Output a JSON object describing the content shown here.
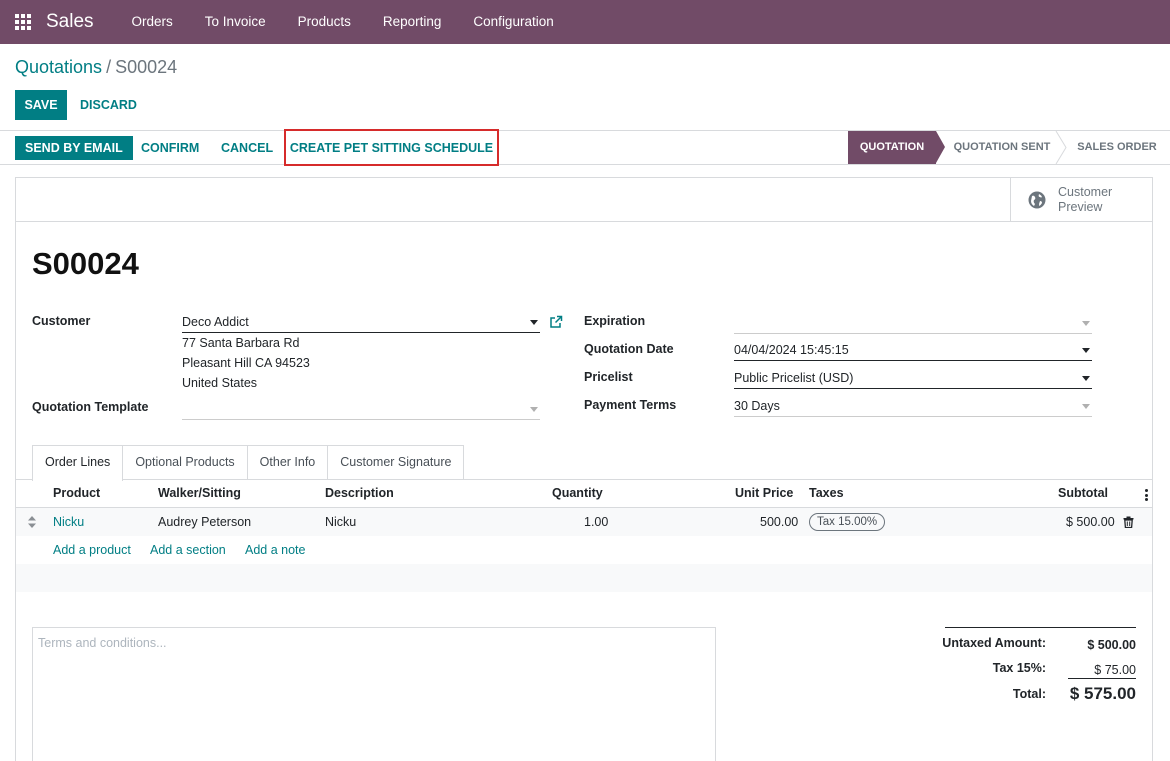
{
  "navbar": {
    "brand": "Sales",
    "menu": [
      "Orders",
      "To Invoice",
      "Products",
      "Reporting",
      "Configuration"
    ],
    "accent_color": "#714B67"
  },
  "breadcrumb": {
    "parent": "Quotations",
    "separator": "/",
    "current": "S00024"
  },
  "form_buttons": {
    "save": "SAVE",
    "discard": "DISCARD"
  },
  "statusbar": {
    "send_email": "SEND BY EMAIL",
    "confirm": "CONFIRM",
    "cancel": "CANCEL",
    "pet_schedule": "CREATE PET SITTING SCHEDULE",
    "stages": [
      "QUOTATION",
      "QUOTATION SENT",
      "SALES ORDER"
    ],
    "active_stage": "QUOTATION"
  },
  "button_box": {
    "preview_line1": "Customer",
    "preview_line2": "Preview",
    "preview_icon": "globe-icon"
  },
  "record": {
    "name": "S00024"
  },
  "fields": {
    "customer_label": "Customer",
    "customer_value": "Deco Addict",
    "address_line1": "77 Santa Barbara Rd",
    "address_line2": "Pleasant Hill CA 94523",
    "address_line3": "United States",
    "template_label": "Quotation Template",
    "template_value": "",
    "expiration_label": "Expiration",
    "expiration_value": "",
    "quotation_date_label": "Quotation Date",
    "quotation_date_value": "04/04/2024 15:45:15",
    "pricelist_label": "Pricelist",
    "pricelist_value": "Public Pricelist (USD)",
    "payment_terms_label": "Payment Terms",
    "payment_terms_value": "30 Days"
  },
  "tabs": [
    "Order Lines",
    "Optional Products",
    "Other Info",
    "Customer Signature"
  ],
  "order_lines": {
    "columns": [
      "Product",
      "Walker/Sitting",
      "Description",
      "Quantity",
      "Unit Price",
      "Taxes",
      "Subtotal"
    ],
    "rows": [
      {
        "product": "Nicku",
        "walker": "Audrey Peterson",
        "description": "Nicku",
        "quantity": "1.00",
        "unit_price": "500.00",
        "taxes": "Tax 15.00%",
        "subtotal": "$ 500.00"
      }
    ],
    "add_product": "Add a product",
    "add_section": "Add a section",
    "add_note": "Add a note"
  },
  "terms": {
    "placeholder": "Terms and conditions..."
  },
  "totals": {
    "untaxed_label": "Untaxed Amount:",
    "untaxed_value": "$ 500.00",
    "tax_label": "Tax 15%:",
    "tax_value": "$ 75.00",
    "total_label": "Total:",
    "total_value": "$ 575.00"
  }
}
